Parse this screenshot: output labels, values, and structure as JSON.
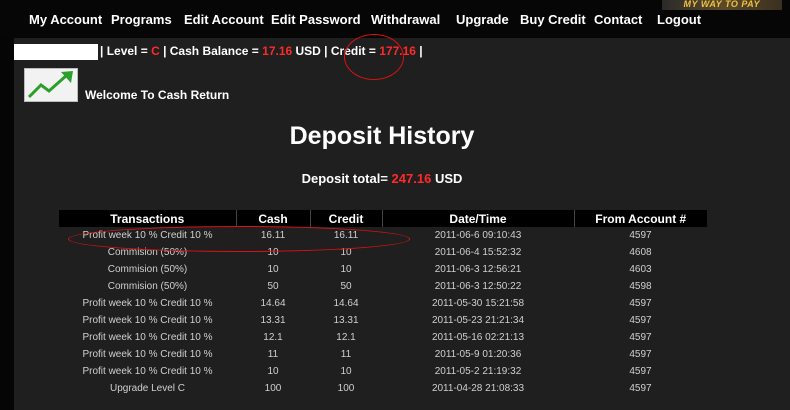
{
  "header": {
    "slogan": "MY WAY TO PAY",
    "nav": [
      {
        "label": "My Account"
      },
      {
        "label": "Programs"
      },
      {
        "label": "Edit Account"
      },
      {
        "label": "Edit Password"
      },
      {
        "label": "Withdrawal"
      },
      {
        "label": "Upgrade"
      },
      {
        "label": "Buy Credit"
      },
      {
        "label": "Contact"
      },
      {
        "label": "Logout"
      }
    ]
  },
  "status": {
    "sep_level": "| Level = ",
    "level": "C",
    "sep_cash": " | Cash Balance = ",
    "cash_balance": "17.16",
    "cash_unit": " USD | Credit = ",
    "credit": "177.16",
    "end": " |"
  },
  "welcome": "Welcome To Cash Return",
  "page_title": "Deposit History",
  "deposit_total": {
    "label": "Deposit total=",
    "value": "247.16",
    "unit": "USD"
  },
  "table": {
    "headers": [
      "Transactions",
      "Cash",
      "Credit",
      "Date/Time",
      "From Account #"
    ],
    "rows": [
      [
        "Profit week 10 % Credit 10 %",
        "16.11",
        "16.11",
        "2011-06-6 09:10:43",
        "4597"
      ],
      [
        "Commision (50%)",
        "10",
        "10",
        "2011-06-4 15:52:32",
        "4608"
      ],
      [
        "Commision (50%)",
        "10",
        "10",
        "2011-06-3 12:56:21",
        "4603"
      ],
      [
        "Commision (50%)",
        "50",
        "50",
        "2011-06-3 12:50:22",
        "4598"
      ],
      [
        "Profit week 10 % Credit 10 %",
        "14.64",
        "14.64",
        "2011-05-30 15:21:58",
        "4597"
      ],
      [
        "Profit week 10 % Credit 10 %",
        "13.31",
        "13.31",
        "2011-05-23 21:21:34",
        "4597"
      ],
      [
        "Profit week 10 % Credit 10 %",
        "12.1",
        "12.1",
        "2011-05-16 02:21:13",
        "4597"
      ],
      [
        "Profit week 10 % Credit 10 %",
        "11",
        "11",
        "2011-05-9 01:20:36",
        "4597"
      ],
      [
        "Profit week 10 % Credit 10 %",
        "10",
        "10",
        "2011-05-2 21:19:32",
        "4597"
      ],
      [
        "Upgrade Level C",
        "100",
        "100",
        "2011-04-28 21:08:33",
        "4597"
      ]
    ]
  }
}
